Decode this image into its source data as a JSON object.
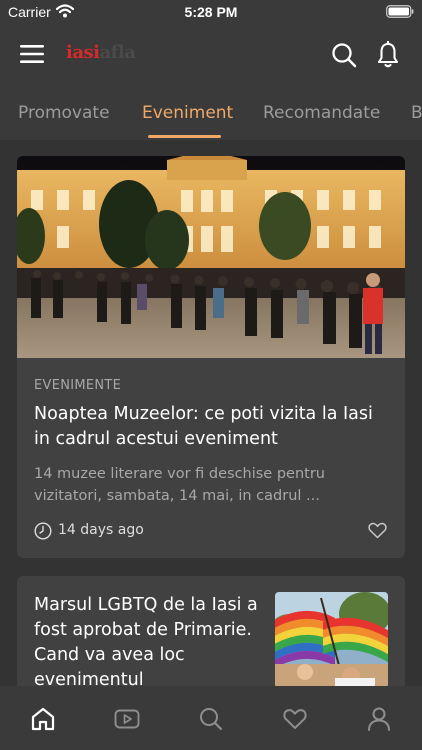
{
  "status_bar": {
    "carrier": "Carrier",
    "time": "5:28 PM"
  },
  "header": {
    "logo_part1": "iasi",
    "logo_part2": "afla",
    "icons": [
      "menu-icon",
      "search-icon",
      "bell-icon"
    ]
  },
  "tabs": [
    {
      "label": "Promovate",
      "active": false
    },
    {
      "label": "Eveniment",
      "active": true
    },
    {
      "label": "Recomandate",
      "active": false
    },
    {
      "label": "B",
      "active": false
    }
  ],
  "feed": {
    "featured": {
      "category": "EVENIMENTE",
      "title": "Noaptea Muzeelor: ce poti vizita la Iasi in cadrul acestui eveniment",
      "summary": "14 muzee literare vor fi deschise pentru vizitatori, sambata, 14 mai, in cadrul ...",
      "time": "14 days ago"
    },
    "second": {
      "title": "Marsul LGBTQ de la Iasi a fost aprobat de Primarie. Cand va avea loc evenimentul"
    }
  },
  "bottom_nav": [
    "home-icon",
    "video-icon",
    "search-icon",
    "heart-icon",
    "profile-icon"
  ],
  "colors": {
    "accent": "#f0a868",
    "logo_red": "#d42a2a",
    "background": "#333333",
    "card": "#414141"
  }
}
